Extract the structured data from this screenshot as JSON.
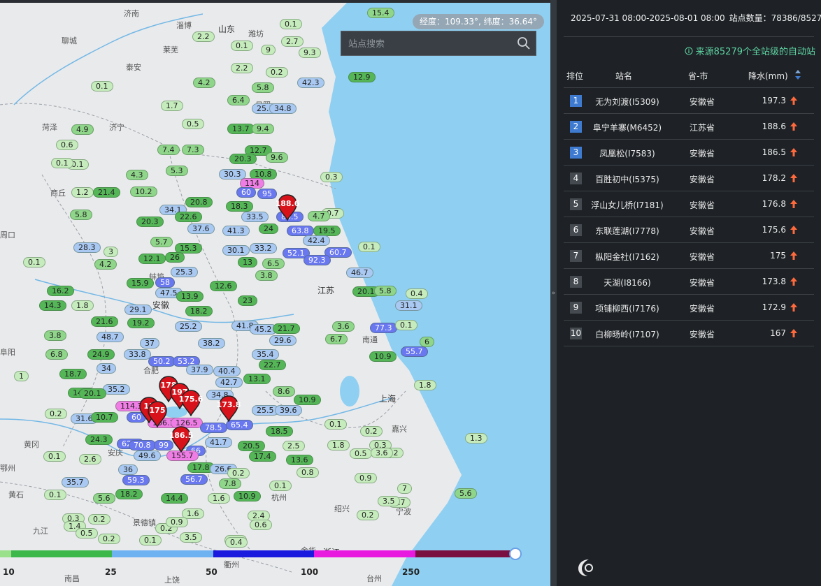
{
  "map": {
    "coordinate_readout": "经度：109.33°, 纬度：36.64°",
    "search_placeholder": "站点搜索",
    "places": [
      {
        "id": "jinan",
        "text": "济南"
      },
      {
        "id": "shandong",
        "text": "山东"
      },
      {
        "id": "zibo",
        "text": "淄博"
      },
      {
        "id": "weifang",
        "text": "潍坊"
      },
      {
        "id": "liaocheng",
        "text": "聊城"
      },
      {
        "id": "laiwu",
        "text": "莱芜"
      },
      {
        "id": "taian",
        "text": "泰安"
      },
      {
        "id": "heze",
        "text": "菏泽"
      },
      {
        "id": "jining",
        "text": "济宁"
      },
      {
        "id": "rizhao",
        "text": "日照"
      },
      {
        "id": "shangqiu",
        "text": "商丘"
      },
      {
        "id": "zhoukou",
        "text": "周口"
      },
      {
        "id": "anhui",
        "text": "安徽"
      },
      {
        "id": "bengbu",
        "text": "蚌埠"
      },
      {
        "id": "jiangsu",
        "text": "江苏"
      },
      {
        "id": "fuyang",
        "text": "阜阳"
      },
      {
        "id": "hefei",
        "text": "合肥"
      },
      {
        "id": "nantong",
        "text": "南通"
      },
      {
        "id": "shanghai",
        "text": "上海"
      },
      {
        "id": "huanggang",
        "text": "黄冈"
      },
      {
        "id": "huangshi",
        "text": "黄石"
      },
      {
        "id": "jiujiang",
        "text": "九江"
      },
      {
        "id": "jingdezhen",
        "text": "景德镇"
      },
      {
        "id": "hangzhou",
        "text": "杭州"
      },
      {
        "id": "shaoxing",
        "text": "绍兴"
      },
      {
        "id": "ningbo",
        "text": "宁波"
      },
      {
        "id": "quzhou",
        "text": "衢州"
      },
      {
        "id": "jinhua",
        "text": "金华"
      },
      {
        "id": "zhejiang",
        "text": "浙江"
      },
      {
        "id": "shangrao",
        "text": "上饶"
      },
      {
        "id": "taizhou",
        "text": "台州"
      },
      {
        "id": "nanchang",
        "text": "南昌"
      },
      {
        "id": "ezhou",
        "text": "鄂州"
      },
      {
        "id": "anqing",
        "text": "安庆"
      },
      {
        "id": "jiaxing",
        "text": "嘉兴"
      }
    ],
    "stations": [
      {
        "v": "15.4",
        "c": 2
      },
      {
        "v": "0.1",
        "c": 1
      },
      {
        "v": "2.2",
        "c": 1
      },
      {
        "v": "0.1",
        "c": 1
      },
      {
        "v": "2.7",
        "c": 1
      },
      {
        "v": "9",
        "c": 1
      },
      {
        "v": "9.3",
        "c": 1
      },
      {
        "v": "2.2",
        "c": 1
      },
      {
        "v": "0.2",
        "c": 1
      },
      {
        "v": "12.9",
        "c": 3
      },
      {
        "v": "0.1",
        "c": 1
      },
      {
        "v": "4.2",
        "c": 2
      },
      {
        "v": "5.8",
        "c": 2
      },
      {
        "v": "42.3",
        "c": 4
      },
      {
        "v": "1.7",
        "c": 1
      },
      {
        "v": "6.4",
        "c": 2
      },
      {
        "v": "25.1",
        "c": 4
      },
      {
        "v": "34.8",
        "c": 4
      },
      {
        "v": "4.9",
        "c": 2
      },
      {
        "v": "0.5",
        "c": 1
      },
      {
        "v": "13.7",
        "c": 3
      },
      {
        "v": "9.4",
        "c": 2
      },
      {
        "v": "0.6",
        "c": 1
      },
      {
        "v": "0.1",
        "c": 1
      },
      {
        "v": "7.4",
        "c": 2
      },
      {
        "v": "7.3",
        "c": 2
      },
      {
        "v": "12.7",
        "c": 3
      },
      {
        "v": "20.3",
        "c": 3
      },
      {
        "v": "9.6",
        "c": 2
      },
      {
        "v": "0.1",
        "c": 1
      },
      {
        "v": "4.3",
        "c": 2
      },
      {
        "v": "5.3",
        "c": 2
      },
      {
        "v": "30.3",
        "c": 4
      },
      {
        "v": "10.8",
        "c": 3
      },
      {
        "v": "0.3",
        "c": 1
      },
      {
        "v": "10.2",
        "c": 2
      },
      {
        "v": "114",
        "c": 6
      },
      {
        "v": "60",
        "c": 5
      },
      {
        "v": "95",
        "c": 5
      },
      {
        "v": "1.2",
        "c": 1
      },
      {
        "v": "21.4",
        "c": 3
      },
      {
        "v": "20.8",
        "c": 3
      },
      {
        "v": "18.3",
        "c": 3
      },
      {
        "v": "0.7",
        "c": 1
      },
      {
        "v": "5.8",
        "c": 2
      },
      {
        "v": "34.1",
        "c": 4
      },
      {
        "v": "22.6",
        "c": 3
      },
      {
        "v": "33.5",
        "c": 4
      },
      {
        "v": "80.5",
        "c": 5
      },
      {
        "v": "4.7",
        "c": 2
      },
      {
        "v": "20.3",
        "c": 3
      },
      {
        "v": "37.6",
        "c": 4
      },
      {
        "v": "41.3",
        "c": 4
      },
      {
        "v": "24",
        "c": 3
      },
      {
        "v": "63.8",
        "c": 5
      },
      {
        "v": "19.5",
        "c": 3
      },
      {
        "v": "28.3",
        "c": 4
      },
      {
        "v": "5.7",
        "c": 2
      },
      {
        "v": "15.3",
        "c": 3
      },
      {
        "v": "30.1",
        "c": 4
      },
      {
        "v": "33.2",
        "c": 4
      },
      {
        "v": "42.4",
        "c": 4
      },
      {
        "v": "0.1",
        "c": 1
      },
      {
        "v": "3",
        "c": 1
      },
      {
        "v": "12.1",
        "c": 3
      },
      {
        "v": "26",
        "c": 3
      },
      {
        "v": "13",
        "c": 3
      },
      {
        "v": "6.5",
        "c": 2
      },
      {
        "v": "52.1",
        "c": 5
      },
      {
        "v": "60.7",
        "c": 5
      },
      {
        "v": "0.1",
        "c": 1
      },
      {
        "v": "4.2",
        "c": 2
      },
      {
        "v": "25.3",
        "c": 4
      },
      {
        "v": "92.3",
        "c": 5
      },
      {
        "v": "46.7",
        "c": 4
      },
      {
        "v": "15.9",
        "c": 3
      },
      {
        "v": "58",
        "c": 5
      },
      {
        "v": "12.6",
        "c": 3
      },
      {
        "v": "3.8",
        "c": 2
      },
      {
        "v": "20.1",
        "c": 3
      },
      {
        "v": "5.8",
        "c": 2
      },
      {
        "v": "16.2",
        "c": 3
      },
      {
        "v": "47.5",
        "c": 4
      },
      {
        "v": "13.9",
        "c": 3
      },
      {
        "v": "23",
        "c": 3
      },
      {
        "v": "0.4",
        "c": 1
      },
      {
        "v": "14.3",
        "c": 3
      },
      {
        "v": "1.8",
        "c": 1
      },
      {
        "v": "29.1",
        "c": 4
      },
      {
        "v": "18.2",
        "c": 3
      },
      {
        "v": "31.1",
        "c": 4
      },
      {
        "v": "21.6",
        "c": 3
      },
      {
        "v": "19.2",
        "c": 3
      },
      {
        "v": "25.2",
        "c": 4
      },
      {
        "v": "41.8",
        "c": 4
      },
      {
        "v": "45.2",
        "c": 4
      },
      {
        "v": "21.7",
        "c": 3
      },
      {
        "v": "3.6",
        "c": 2
      },
      {
        "v": "77.3",
        "c": 5
      },
      {
        "v": "0.1",
        "c": 1
      },
      {
        "v": "3.8",
        "c": 2
      },
      {
        "v": "48.7",
        "c": 4
      },
      {
        "v": "37",
        "c": 4
      },
      {
        "v": "38.2",
        "c": 4
      },
      {
        "v": "29.6",
        "c": 4
      },
      {
        "v": "6.7",
        "c": 2
      },
      {
        "v": "6",
        "c": 2
      },
      {
        "v": "24.9",
        "c": 3
      },
      {
        "v": "33.8",
        "c": 4
      },
      {
        "v": "35.4",
        "c": 4
      },
      {
        "v": "10.9",
        "c": 3
      },
      {
        "v": "55.7",
        "c": 5
      },
      {
        "v": "6.8",
        "c": 2
      },
      {
        "v": "34",
        "c": 4
      },
      {
        "v": "50.2",
        "c": 5
      },
      {
        "v": "53.2",
        "c": 5
      },
      {
        "v": "22.7",
        "c": 3
      },
      {
        "v": "18.7",
        "c": 3
      },
      {
        "v": "37.9",
        "c": 4
      },
      {
        "v": "40.4",
        "c": 4
      },
      {
        "v": "1",
        "c": 1
      },
      {
        "v": "35.2",
        "c": 4
      },
      {
        "v": "42.7",
        "c": 4
      },
      {
        "v": "13.1",
        "c": 3
      },
      {
        "v": "1.8",
        "c": 1
      },
      {
        "v": "14.7",
        "c": 3
      },
      {
        "v": "20.1",
        "c": 3
      },
      {
        "v": "34.8",
        "c": 4
      },
      {
        "v": "8.6",
        "c": 2
      },
      {
        "v": "10.9",
        "c": 3
      },
      {
        "v": "0.2",
        "c": 1
      },
      {
        "v": "114.3",
        "c": 6
      },
      {
        "v": "60",
        "c": 5
      },
      {
        "v": "25.5",
        "c": 4
      },
      {
        "v": "39.6",
        "c": 4
      },
      {
        "v": "31.6",
        "c": 4
      },
      {
        "v": "10.7",
        "c": 3
      },
      {
        "v": "166.1",
        "c": 6
      },
      {
        "v": "126.5",
        "c": 6
      },
      {
        "v": "78.5",
        "c": 5
      },
      {
        "v": "65.4",
        "c": 5
      },
      {
        "v": "18.5",
        "c": 3
      },
      {
        "v": "0.1",
        "c": 1
      },
      {
        "v": "0.2",
        "c": 1
      },
      {
        "v": "24.3",
        "c": 3
      },
      {
        "v": "62.1",
        "c": 5
      },
      {
        "v": "70.8",
        "c": 5
      },
      {
        "v": "99",
        "c": 5
      },
      {
        "v": "41.7",
        "c": 4
      },
      {
        "v": "20.5",
        "c": 3
      },
      {
        "v": "2.5",
        "c": 1
      },
      {
        "v": "1.8",
        "c": 1
      },
      {
        "v": "0.3",
        "c": 1
      },
      {
        "v": "0.2",
        "c": 1
      },
      {
        "v": "49.6",
        "c": 4
      },
      {
        "v": "66",
        "c": 5
      },
      {
        "v": "155.7",
        "c": 6
      },
      {
        "v": "17.4",
        "c": 3
      },
      {
        "v": "13.6",
        "c": 3
      },
      {
        "v": "0.5",
        "c": 1
      },
      {
        "v": "3.6",
        "c": 1
      },
      {
        "v": "0.1",
        "c": 1
      },
      {
        "v": "2.6",
        "c": 1
      },
      {
        "v": "36",
        "c": 4
      },
      {
        "v": "17.8",
        "c": 3
      },
      {
        "v": "26.6",
        "c": 4
      },
      {
        "v": "0.2",
        "c": 1
      },
      {
        "v": "0.8",
        "c": 1
      },
      {
        "v": "0.9",
        "c": 1
      },
      {
        "v": "35.7",
        "c": 4
      },
      {
        "v": "59.3",
        "c": 5
      },
      {
        "v": "56.7",
        "c": 5
      },
      {
        "v": "7.8",
        "c": 2
      },
      {
        "v": "0.1",
        "c": 1
      },
      {
        "v": "7",
        "c": 1
      },
      {
        "v": "0.1",
        "c": 1
      },
      {
        "v": "5.6",
        "c": 2
      },
      {
        "v": "18.2",
        "c": 3
      },
      {
        "v": "14.4",
        "c": 3
      },
      {
        "v": "1.6",
        "c": 1
      },
      {
        "v": "10.9",
        "c": 3
      },
      {
        "v": "0.3",
        "c": 1
      },
      {
        "v": "0.2",
        "c": 1
      },
      {
        "v": "1.6",
        "c": 1
      },
      {
        "v": "2.4",
        "c": 1
      },
      {
        "v": "0.7",
        "c": 1
      },
      {
        "v": "1.4",
        "c": 1
      },
      {
        "v": "0.5",
        "c": 1
      },
      {
        "v": "0.2",
        "c": 1
      },
      {
        "v": "0.9",
        "c": 1
      },
      {
        "v": "0.6",
        "c": 1
      },
      {
        "v": "3.5",
        "c": 1
      },
      {
        "v": "0.4",
        "c": 1
      },
      {
        "v": "0.1",
        "c": 1
      },
      {
        "v": "0.2",
        "c": 1
      },
      {
        "v": "3.5",
        "c": 1
      },
      {
        "v": "0.2",
        "c": 1
      },
      {
        "v": "0.4",
        "c": 1
      },
      {
        "v": "5.6",
        "c": 2
      },
      {
        "v": "1.3",
        "c": 1
      }
    ],
    "markers": [
      {
        "label": "188.6"
      },
      {
        "label": "178"
      },
      {
        "label": "197"
      },
      {
        "label": "175.6"
      },
      {
        "label": "173.8"
      },
      {
        "label": "11"
      },
      {
        "label": "175"
      },
      {
        "label": "186.5"
      }
    ],
    "legend": {
      "segments": [
        {
          "color": "#9be08b"
        },
        {
          "color": "#3cb84a"
        },
        {
          "color": "#6fb2f2"
        },
        {
          "color": "#1a1adf"
        },
        {
          "color": "#e81ae0"
        },
        {
          "color": "#7a0f42"
        }
      ],
      "labels": [
        "10",
        "25",
        "50",
        "100",
        "250"
      ]
    }
  },
  "panel": {
    "period": "2025-07-31 08:00-2025-08-01 08:00",
    "station_count": "站点数量：78386/85279",
    "source_note": "来源85279个全站级的自动站",
    "headers": {
      "rank": "排位",
      "name": "站名",
      "province": "省-市",
      "rain": "降水(mm)"
    },
    "rows": [
      {
        "rank": "1",
        "name": "无为刘渡(I5309)",
        "province": "安徽省",
        "rain": "197.3"
      },
      {
        "rank": "2",
        "name": "阜宁羊寨(M6452)",
        "province": "江苏省",
        "rain": "188.6"
      },
      {
        "rank": "3",
        "name": "凤凰松(I7583)",
        "province": "安徽省",
        "rain": "186.5"
      },
      {
        "rank": "4",
        "name": "百胜初中(I5375)",
        "province": "安徽省",
        "rain": "178.2"
      },
      {
        "rank": "5",
        "name": "浮山女儿桥(I7181)",
        "province": "安徽省",
        "rain": "176.8"
      },
      {
        "rank": "6",
        "name": "东联莲湖(I7778)",
        "province": "安徽省",
        "rain": "175.6"
      },
      {
        "rank": "7",
        "name": "枞阳金社(I7162)",
        "province": "安徽省",
        "rain": "175"
      },
      {
        "rank": "8",
        "name": "天湖(I8166)",
        "province": "安徽省",
        "rain": "173.8"
      },
      {
        "rank": "9",
        "name": "项铺柳西(I7176)",
        "province": "安徽省",
        "rain": "172.9"
      },
      {
        "rank": "10",
        "name": "白柳旸岭(I7107)",
        "province": "安徽省",
        "rain": "167"
      }
    ],
    "colors": {
      "accent": "#3e7bd0",
      "source_text": "#5ed3a2",
      "up_arrow": "#ff6a3d",
      "marker": "#d8121b"
    }
  }
}
